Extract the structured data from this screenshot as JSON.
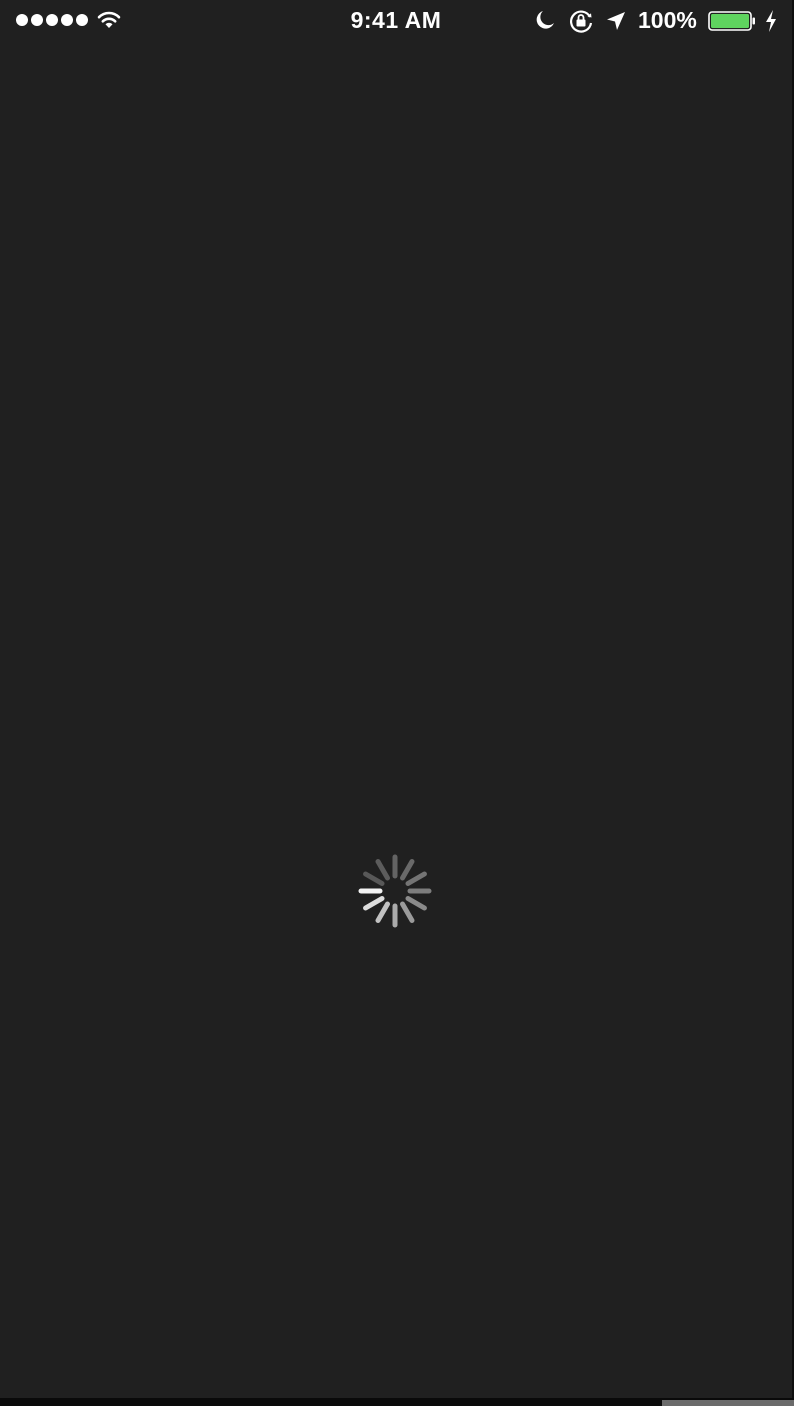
{
  "status_bar": {
    "signal_dots": 5,
    "time": "9:41 AM",
    "battery_percent": "100%",
    "battery_level": 1.0,
    "icons": [
      "signal-dots-icon",
      "wifi-icon",
      "moon-icon",
      "rotation-lock-icon",
      "location-arrow-icon",
      "battery-icon",
      "charging-bolt-icon"
    ]
  },
  "content": {
    "state": "loading",
    "spinner_icon": "activity-indicator-icon"
  },
  "colors": {
    "background": "#202020",
    "status_text": "#ffffff",
    "battery_fill": "#5fd35f",
    "spinner_strokes": "#9a9a9a"
  }
}
